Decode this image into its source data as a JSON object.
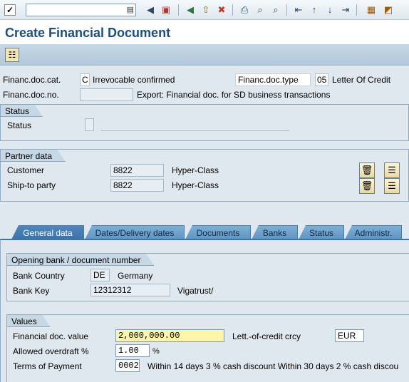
{
  "title": "Create Financial Document",
  "header": {
    "doc_cat_label": "Financ.doc.cat.",
    "doc_cat_value": "C",
    "doc_cat_text": "Irrevocable confirmed",
    "doc_type_label": "Financ.doc.type",
    "doc_type_value": "05",
    "doc_type_text": "Letter Of Credit",
    "doc_no_label": "Financ.doc.no.",
    "doc_no_value": "",
    "doc_no_text": "Export: Financial doc. for SD business transactions"
  },
  "status": {
    "group_label": "Status",
    "status_label": "Status",
    "status_value": "",
    "status_text": ""
  },
  "partner": {
    "group_label": "Partner data",
    "customer_label": "Customer",
    "customer_value": "8822",
    "customer_name": "Hyper-Class",
    "shipto_label": "Ship-to party",
    "shipto_value": "8822",
    "shipto_name": "Hyper-Class"
  },
  "tabs": [
    {
      "label": "General data",
      "active": true
    },
    {
      "label": "Dates/Delivery dates"
    },
    {
      "label": "Documents"
    },
    {
      "label": "Banks"
    },
    {
      "label": "Status"
    },
    {
      "label": "Administr."
    }
  ],
  "opening_bank": {
    "group_label": "Opening bank / document number",
    "country_label": "Bank Country",
    "country_value": "DE",
    "country_name": "Germany",
    "key_label": "Bank Key",
    "key_value": "12312312",
    "key_name": "Vigatrust/"
  },
  "values": {
    "group_label": "Values",
    "fin_value_label": "Financial doc. value",
    "fin_value": "2,000,000.00",
    "lc_crcy_label": "Lett.-of-credit crcy",
    "lc_crcy_value": "EUR",
    "overdraft_label": "Allowed overdraft %",
    "overdraft_value": "1.00",
    "overdraft_unit": "%",
    "terms_label": "Terms of Payment",
    "terms_value": "0002",
    "terms_text": "Within 14 days 3 % cash discount Within 30 days 2 % cash discou"
  },
  "colors": {
    "title": "#1a4e86",
    "active_tab": "#3c73a8",
    "highlight_field": "#fff5a8"
  }
}
